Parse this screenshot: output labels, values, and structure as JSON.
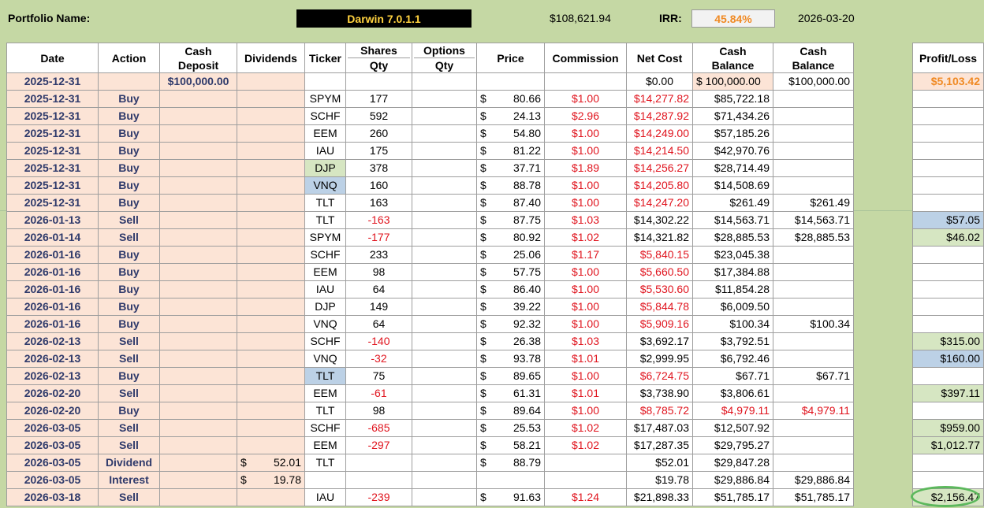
{
  "header": {
    "portfolio_label": "Portfolio Name:",
    "portfolio_name": "Darwin 7.0.1.1",
    "total_value": "$108,621.94",
    "irr_label": "IRR:",
    "irr_value": "45.84%",
    "date": "2026-03-20"
  },
  "columns": {
    "date": "Date",
    "action": "Action",
    "cash_deposit_1": "Cash",
    "cash_deposit_2": "Deposit",
    "dividends": "Dividends",
    "ticker": "Ticker",
    "shares_1": "Shares",
    "shares_2": "Qty",
    "options_1": "Options",
    "options_2": "Qty",
    "price": "Price",
    "commission": "Commission",
    "net_cost": "Net Cost",
    "cash_balance_1": "Cash",
    "cash_balance_2": "Balance",
    "cash_balance2_1": "Cash",
    "cash_balance2_2": "Balance",
    "profit_loss": "Profit/Loss"
  },
  "rows": [
    {
      "date": "2025-12-31",
      "action": "",
      "deposit": "$100,000.00",
      "div_sym": "",
      "div": "",
      "ticker": "",
      "shares": "",
      "options": "",
      "price_sym": "",
      "price": "",
      "commission": "",
      "net_cost": "$0.00",
      "cash_balance": "$  100,000.00",
      "cash_balance2": "$100,000.00",
      "pl": "$5,103.42"
    },
    {
      "date": "2025-12-31",
      "action": "Buy",
      "deposit": "",
      "div_sym": "",
      "div": "",
      "ticker": "SPYM",
      "shares": "177",
      "options": "",
      "price_sym": "$",
      "price": "80.66",
      "commission": "$1.00",
      "net_cost": "$14,277.82",
      "cash_balance": "$85,722.18",
      "cash_balance2": "",
      "pl": ""
    },
    {
      "date": "2025-12-31",
      "action": "Buy",
      "deposit": "",
      "div_sym": "",
      "div": "",
      "ticker": "SCHF",
      "shares": "592",
      "options": "",
      "price_sym": "$",
      "price": "24.13",
      "commission": "$2.96",
      "net_cost": "$14,287.92",
      "cash_balance": "$71,434.26",
      "cash_balance2": "",
      "pl": ""
    },
    {
      "date": "2025-12-31",
      "action": "Buy",
      "deposit": "",
      "div_sym": "",
      "div": "",
      "ticker": "EEM",
      "shares": "260",
      "options": "",
      "price_sym": "$",
      "price": "54.80",
      "commission": "$1.00",
      "net_cost": "$14,249.00",
      "cash_balance": "$57,185.26",
      "cash_balance2": "",
      "pl": ""
    },
    {
      "date": "2025-12-31",
      "action": "Buy",
      "deposit": "",
      "div_sym": "",
      "div": "",
      "ticker": "IAU",
      "shares": "175",
      "options": "",
      "price_sym": "$",
      "price": "81.22",
      "commission": "$1.00",
      "net_cost": "$14,214.50",
      "cash_balance": "$42,970.76",
      "cash_balance2": "",
      "pl": ""
    },
    {
      "date": "2025-12-31",
      "action": "Buy",
      "deposit": "",
      "div_sym": "",
      "div": "",
      "ticker": "DJP",
      "shares": "378",
      "options": "",
      "price_sym": "$",
      "price": "37.71",
      "commission": "$1.89",
      "net_cost": "$14,256.27",
      "cash_balance": "$28,714.49",
      "cash_balance2": "",
      "pl": ""
    },
    {
      "date": "2025-12-31",
      "action": "Buy",
      "deposit": "",
      "div_sym": "",
      "div": "",
      "ticker": "VNQ",
      "shares": "160",
      "options": "",
      "price_sym": "$",
      "price": "88.78",
      "commission": "$1.00",
      "net_cost": "$14,205.80",
      "cash_balance": "$14,508.69",
      "cash_balance2": "",
      "pl": ""
    },
    {
      "date": "2025-12-31",
      "action": "Buy",
      "deposit": "",
      "div_sym": "",
      "div": "",
      "ticker": "TLT",
      "shares": "163",
      "options": "",
      "price_sym": "$",
      "price": "87.40",
      "commission": "$1.00",
      "net_cost": "$14,247.20",
      "cash_balance": "$261.49",
      "cash_balance2": "$261.49",
      "pl": ""
    },
    {
      "date": "2026-01-13",
      "action": "Sell",
      "deposit": "",
      "div_sym": "",
      "div": "",
      "ticker": "TLT",
      "shares": "-163",
      "options": "",
      "price_sym": "$",
      "price": "87.75",
      "commission": "$1.03",
      "net_cost": "$14,302.22",
      "cash_balance": "$14,563.71",
      "cash_balance2": "$14,563.71",
      "pl": "$57.05"
    },
    {
      "date": "2026-01-14",
      "action": "Sell",
      "deposit": "",
      "div_sym": "",
      "div": "",
      "ticker": "SPYM",
      "shares": "-177",
      "options": "",
      "price_sym": "$",
      "price": "80.92",
      "commission": "$1.02",
      "net_cost": "$14,321.82",
      "cash_balance": "$28,885.53",
      "cash_balance2": "$28,885.53",
      "pl": "$46.02"
    },
    {
      "date": "2026-01-16",
      "action": "Buy",
      "deposit": "",
      "div_sym": "",
      "div": "",
      "ticker": "SCHF",
      "shares": "233",
      "options": "",
      "price_sym": "$",
      "price": "25.06",
      "commission": "$1.17",
      "net_cost": "$5,840.15",
      "cash_balance": "$23,045.38",
      "cash_balance2": "",
      "pl": ""
    },
    {
      "date": "2026-01-16",
      "action": "Buy",
      "deposit": "",
      "div_sym": "",
      "div": "",
      "ticker": "EEM",
      "shares": "98",
      "options": "",
      "price_sym": "$",
      "price": "57.75",
      "commission": "$1.00",
      "net_cost": "$5,660.50",
      "cash_balance": "$17,384.88",
      "cash_balance2": "",
      "pl": ""
    },
    {
      "date": "2026-01-16",
      "action": "Buy",
      "deposit": "",
      "div_sym": "",
      "div": "",
      "ticker": "IAU",
      "shares": "64",
      "options": "",
      "price_sym": "$",
      "price": "86.40",
      "commission": "$1.00",
      "net_cost": "$5,530.60",
      "cash_balance": "$11,854.28",
      "cash_balance2": "",
      "pl": ""
    },
    {
      "date": "2026-01-16",
      "action": "Buy",
      "deposit": "",
      "div_sym": "",
      "div": "",
      "ticker": "DJP",
      "shares": "149",
      "options": "",
      "price_sym": "$",
      "price": "39.22",
      "commission": "$1.00",
      "net_cost": "$5,844.78",
      "cash_balance": "$6,009.50",
      "cash_balance2": "",
      "pl": ""
    },
    {
      "date": "2026-01-16",
      "action": "Buy",
      "deposit": "",
      "div_sym": "",
      "div": "",
      "ticker": "VNQ",
      "shares": "64",
      "options": "",
      "price_sym": "$",
      "price": "92.32",
      "commission": "$1.00",
      "net_cost": "$5,909.16",
      "cash_balance": "$100.34",
      "cash_balance2": "$100.34",
      "pl": ""
    },
    {
      "date": "2026-02-13",
      "action": "Sell",
      "deposit": "",
      "div_sym": "",
      "div": "",
      "ticker": "SCHF",
      "shares": "-140",
      "options": "",
      "price_sym": "$",
      "price": "26.38",
      "commission": "$1.03",
      "net_cost": "$3,692.17",
      "cash_balance": "$3,792.51",
      "cash_balance2": "",
      "pl": "$315.00"
    },
    {
      "date": "2026-02-13",
      "action": "Sell",
      "deposit": "",
      "div_sym": "",
      "div": "",
      "ticker": "VNQ",
      "shares": "-32",
      "options": "",
      "price_sym": "$",
      "price": "93.78",
      "commission": "$1.01",
      "net_cost": "$2,999.95",
      "cash_balance": "$6,792.46",
      "cash_balance2": "",
      "pl": "$160.00"
    },
    {
      "date": "2026-02-13",
      "action": "Buy",
      "deposit": "",
      "div_sym": "",
      "div": "",
      "ticker": "TLT",
      "shares": "75",
      "options": "",
      "price_sym": "$",
      "price": "89.65",
      "commission": "$1.00",
      "net_cost": "$6,724.75",
      "cash_balance": "$67.71",
      "cash_balance2": "$67.71",
      "pl": ""
    },
    {
      "date": "2026-02-20",
      "action": "Sell",
      "deposit": "",
      "div_sym": "",
      "div": "",
      "ticker": "EEM",
      "shares": "-61",
      "options": "",
      "price_sym": "$",
      "price": "61.31",
      "commission": "$1.01",
      "net_cost": "$3,738.90",
      "cash_balance": "$3,806.61",
      "cash_balance2": "",
      "pl": "$397.11"
    },
    {
      "date": "2026-02-20",
      "action": "Buy",
      "deposit": "",
      "div_sym": "",
      "div": "",
      "ticker": "TLT",
      "shares": "98",
      "options": "",
      "price_sym": "$",
      "price": "89.64",
      "commission": "$1.00",
      "net_cost": "$8,785.72",
      "cash_balance": "$4,979.11",
      "cash_balance2": "$4,979.11",
      "pl": ""
    },
    {
      "date": "2026-03-05",
      "action": "Sell",
      "deposit": "",
      "div_sym": "",
      "div": "",
      "ticker": "SCHF",
      "shares": "-685",
      "options": "",
      "price_sym": "$",
      "price": "25.53",
      "commission": "$1.02",
      "net_cost": "$17,487.03",
      "cash_balance": "$12,507.92",
      "cash_balance2": "",
      "pl": "$959.00"
    },
    {
      "date": "2026-03-05",
      "action": "Sell",
      "deposit": "",
      "div_sym": "",
      "div": "",
      "ticker": "EEM",
      "shares": "-297",
      "options": "",
      "price_sym": "$",
      "price": "58.21",
      "commission": "$1.02",
      "net_cost": "$17,287.35",
      "cash_balance": "$29,795.27",
      "cash_balance2": "",
      "pl": "$1,012.77"
    },
    {
      "date": "2026-03-05",
      "action": "Dividend",
      "deposit": "",
      "div_sym": "$",
      "div": "52.01",
      "ticker": "TLT",
      "shares": "",
      "options": "",
      "price_sym": "$",
      "price": "88.79",
      "commission": "",
      "net_cost": "$52.01",
      "cash_balance": "$29,847.28",
      "cash_balance2": "",
      "pl": ""
    },
    {
      "date": "2026-03-05",
      "action": "Interest",
      "deposit": "",
      "div_sym": "$",
      "div": "19.78",
      "ticker": "",
      "shares": "",
      "options": "",
      "price_sym": "",
      "price": "",
      "commission": "",
      "net_cost": "$19.78",
      "cash_balance": "$29,886.84",
      "cash_balance2": "$29,886.84",
      "pl": ""
    },
    {
      "date": "2026-03-18",
      "action": "Sell",
      "deposit": "",
      "div_sym": "",
      "div": "",
      "ticker": "IAU",
      "shares": "-239",
      "options": "",
      "price_sym": "$",
      "price": "91.63",
      "commission": "$1.24",
      "net_cost": "$21,898.33",
      "cash_balance": "$51,785.17",
      "cash_balance2": "$51,785.17",
      "pl": "$2,156.47"
    }
  ],
  "styles": {
    "ticker_green_rows": [
      5
    ],
    "ticker_blue_rows": [
      6,
      17
    ],
    "red_net_cost_rows": [
      1,
      2,
      3,
      4,
      5,
      6,
      7,
      10,
      11,
      12,
      13,
      14,
      17,
      19
    ],
    "red_cash_balance_rows": [
      19
    ],
    "red_cash_balance2_rows": [
      19
    ],
    "white_cash_balance_rows": [
      1,
      2,
      3,
      4,
      5,
      6,
      7,
      8,
      9,
      10,
      11,
      12,
      13,
      14,
      15,
      16,
      17,
      18,
      19,
      20,
      21,
      22,
      23,
      24
    ],
    "pl_green_rows": [
      9,
      15,
      18,
      20,
      21,
      24
    ],
    "pl_blue_rows": [
      8,
      16
    ],
    "pl_orange_rows": [
      0
    ],
    "colors": {
      "accent_orange": "#f08a24",
      "buy_sell_navy": "#2f3a6b",
      "negative_red": "#e0141e",
      "row_peach": "#fce4d6",
      "bg_green": "#c5d8a4",
      "highlight_green": "#5cb85c"
    }
  }
}
